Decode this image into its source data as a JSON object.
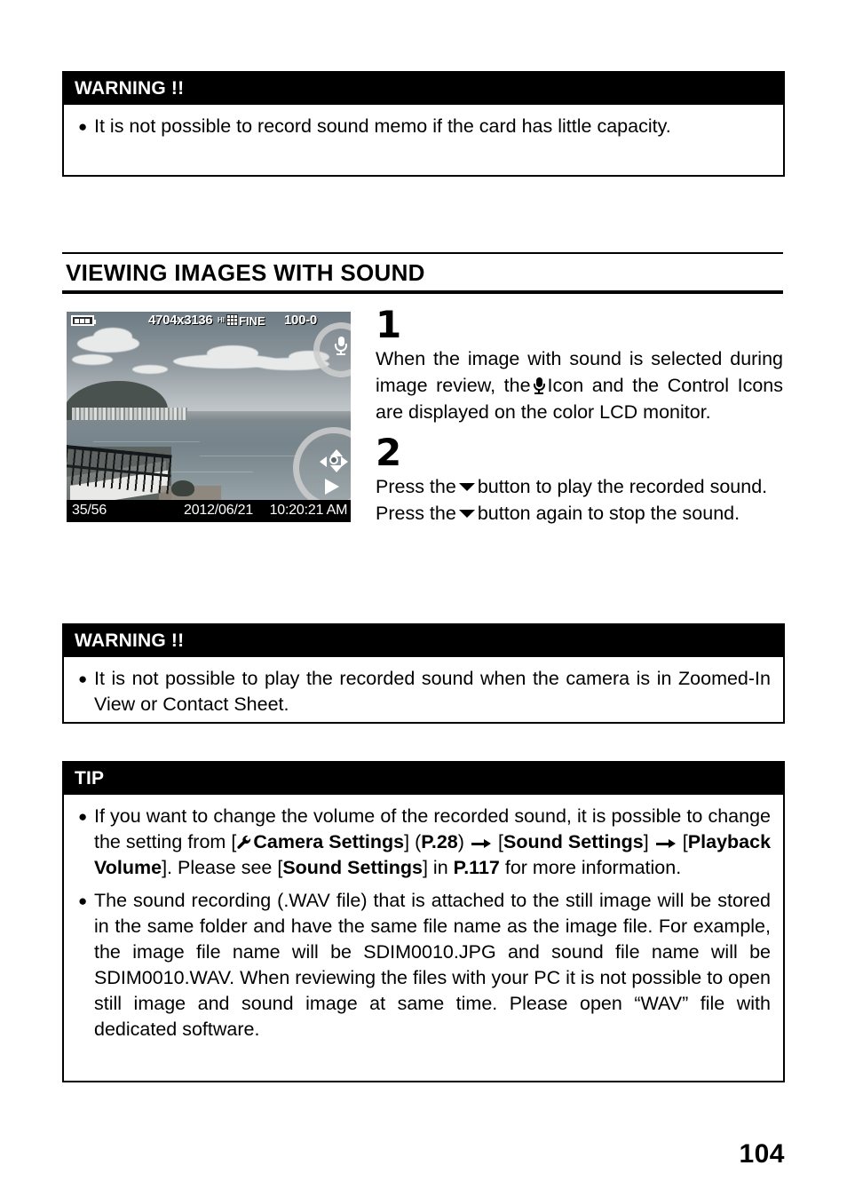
{
  "page": {
    "number": "104"
  },
  "warning_top": {
    "header": "WARNING !!",
    "bullets": [
      "It is not possible to record sound memo if the card has little capacity."
    ]
  },
  "section": {
    "heading": "VIEWING IMAGES WITH SOUND"
  },
  "camera_lcd": {
    "battery_icon": "battery-icon",
    "resolution": "4704x3136",
    "quality_hi_mark": "HI",
    "quality_grid_icon": "resolution-grid-icon",
    "quality_label": "FINE",
    "file_number": "100-0",
    "frame_counter": "35/56",
    "date": "2012/06/21",
    "time": "10:20:21 AM",
    "mic_icon": "microphone-icon",
    "control_pad_icon": "four-way-control-pad-icon",
    "play_icon": "play-triangle-icon",
    "highlight_ring_mic": "highlight-ring",
    "highlight_ring_control": "highlight-ring"
  },
  "steps": [
    {
      "number": "1",
      "text_before_icon": "When the image with sound is selected during image review, the",
      "icon": "microphone-icon",
      "text_after_icon": "Icon and the Control Icons are displayed on the color LCD monitor."
    },
    {
      "number": "2",
      "line1_before": "Press the",
      "line1_icon": "arrow-down-icon",
      "line1_after": "button to play the recorded sound.",
      "line2_before": "Press the",
      "line2_icon": "arrow-down-icon",
      "line2_after": "button again to stop the sound."
    }
  ],
  "warning_bottom": {
    "header": "WARNING !!",
    "bullets": [
      "It is not possible to play the recorded sound when the camera is in Zoomed-In View or Contact Sheet."
    ]
  },
  "tip": {
    "header": "TIP",
    "bullet1": {
      "seg1": "If you want to change the volume of the recorded sound, it is possible to change the setting from [",
      "wrench_icon": "wrench-icon",
      "menu1": "Camera Settings",
      "seg2": "] (",
      "page_ref1": "P.28",
      "seg3": ") ",
      "arrow_icon": "arrow-right-icon",
      "seg4": " [",
      "menu2": "Sound Settings",
      "seg5": "] ",
      "arrow_icon2": "arrow-right-icon",
      "seg6": " [",
      "menu3": "Playback Volume",
      "seg7": "]. Please see [",
      "menu4": "Sound Settings",
      "seg8": "] in ",
      "page_ref2": "P.117",
      "seg9": " for more information."
    },
    "bullet2": "The sound recording (.WAV file) that is attached to the still image will be stored in the same folder and have the same file name as the image file. For example, the image file name will be SDIM0010.JPG and sound file name will be SDIM0010.WAV. When reviewing the files with your PC it is not possible to open still image and sound image at same time. Please open “WAV” file with dedicated software."
  }
}
